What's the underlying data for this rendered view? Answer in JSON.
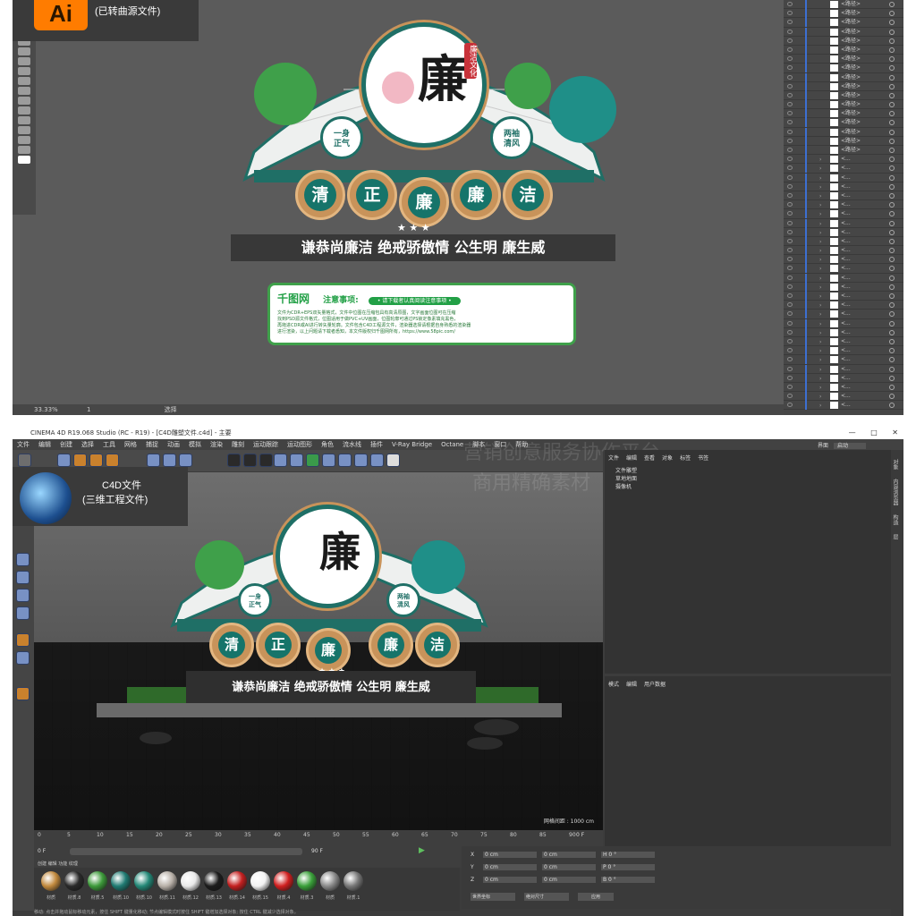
{
  "ai_window": {
    "badge_app": "Ai",
    "badge_text": "(已转曲源文件)",
    "status_zoom": "33.33%",
    "status_page": "1",
    "status_tool": "选择",
    "layer_name": "<路径>",
    "layer_name_short": "<..."
  },
  "design": {
    "center_char": "廉",
    "seal_text": "廉洁文化",
    "left_badge": "一身正气",
    "right_badge": "两袖清风",
    "medals": [
      "清",
      "正",
      "廉",
      "廉",
      "洁"
    ],
    "stars": "★ ★ ★",
    "slogan": "谦恭尚廉洁 绝戒骄傲情 公生明 廉生威"
  },
  "notice": {
    "brand": "千图网",
    "title": "注意事项:",
    "pill": "• 请下载者认真阅读注意事项 •",
    "body_line1": "文件为CDR+EPS双矢量格式，文件中位图在压缩包具有高清原图，文字画面位图可在压缩",
    "body_line2": "找到PSD源文件格式，位图适用于做PVC+UV画面，位图轮廓可通过PS锁定像素填充黑色，",
    "body_line3": "再拖进CDR或AI进行转矢量轮廓。文件包含C4D工程源文件，渲染器选择请根据自身熟悉的渲染器",
    "body_line4": "进行渲染，以上问题请下载者悉知，本文件版权归千图网所有，https://www.58pic.com/"
  },
  "c4d_window": {
    "title": "CINEMA 4D R19.068 Studio (RC - R19) - [C4D雕塑文件.c4d] - 主要",
    "menu": [
      "文件",
      "编辑",
      "创建",
      "选择",
      "工具",
      "网格",
      "捕捉",
      "动画",
      "模拟",
      "渲染",
      "雕刻",
      "运动跟踪",
      "运动图形",
      "角色",
      "流水线",
      "插件",
      "V-Ray Bridge",
      "Octane",
      "脚本",
      "窗口",
      "帮助"
    ],
    "badge_title": "C4D文件",
    "badge_sub": "(三维工程文件)",
    "watermark_line1": "营销创意服务协作平台",
    "watermark_line2": "商用精确素材",
    "obj_tabs": [
      "文件",
      "编辑",
      "查看",
      "对象",
      "标签",
      "书签"
    ],
    "objects": [
      "文件雕塑",
      "草地地面",
      "摄像机"
    ],
    "attr_tabs": [
      "模式",
      "编辑",
      "用户数据"
    ],
    "layout_label": "界面",
    "layout_value": "启动",
    "grid_label": "网格间距 : 1000 cm",
    "timeline_ticks": [
      "0",
      "5",
      "10",
      "15",
      "20",
      "25",
      "30",
      "35",
      "40",
      "45",
      "50",
      "55",
      "60",
      "65",
      "70",
      "75",
      "80",
      "85",
      "90"
    ],
    "frame_start": "0 F",
    "frame_end": "90 F",
    "frame_current": "0 F",
    "mat_tabs": [
      "创建",
      "编辑",
      "功能",
      "纹理"
    ],
    "materials": [
      {
        "name": "材质",
        "color": "#c28a3e"
      },
      {
        "name": "材质.8",
        "color": "#2a2a2a"
      },
      {
        "name": "材质.5",
        "color": "#3d9a3a"
      },
      {
        "name": "材质.10",
        "color": "#1f7a72"
      },
      {
        "name": "材质.10",
        "color": "#238877"
      },
      {
        "name": "材质.11",
        "color": "#b8b0a8"
      },
      {
        "name": "材质.12",
        "color": "#e9e9e9"
      },
      {
        "name": "材质.13",
        "color": "#1c1c1c"
      },
      {
        "name": "材质.14",
        "color": "#c42020"
      },
      {
        "name": "材质.15",
        "color": "#f2f2f2"
      },
      {
        "name": "材质.4",
        "color": "#d01f1f"
      },
      {
        "name": "材质.3",
        "color": "#3aa03a"
      },
      {
        "name": "材质",
        "color": "#8a8a8a"
      },
      {
        "name": "材质.1",
        "color": "#777777"
      }
    ],
    "coord_rows": [
      {
        "axis": "X",
        "pos": "0 cm",
        "size": "0 cm",
        "rot": "H 0 °"
      },
      {
        "axis": "Y",
        "pos": "0 cm",
        "size": "0 cm",
        "rot": "P 0 °"
      },
      {
        "axis": "Z",
        "pos": "0 cm",
        "size": "0 cm",
        "rot": "B 0 °"
      }
    ],
    "coord_world": "世界坐标",
    "coord_scale": "绝对尺寸",
    "coord_apply": "应用",
    "status_bar": "移动: 点击并拖动鼠标移动元素，按住 SHIFT 键量化移动; 节点编辑模式时按住 SHIFT 键增加选择对象; 按住 CTRL 键减少选择对象。",
    "right_tabs": [
      "对象",
      "内容浏览器",
      "构造",
      "层"
    ]
  }
}
